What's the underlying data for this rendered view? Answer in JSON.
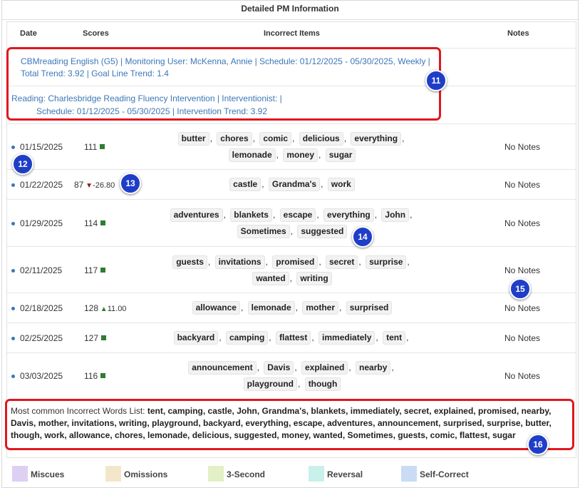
{
  "panel": {
    "title": "Detailed PM Information"
  },
  "columns": {
    "date": "Date",
    "scores": "Scores",
    "incorrect": "Incorrect Items",
    "notes": "Notes"
  },
  "monitoring": {
    "line1": "CBMreading English (G5) | Monitoring User: McKenna, Annie | Schedule: 01/12/2025 - 05/30/2025, Weekly |",
    "line2": "Total Trend: 3.92 | Goal Line Trend: 1.4"
  },
  "intervention": {
    "line1": "Reading: Charlesbridge Reading Fluency Intervention | Interventionist: |",
    "line2": "Schedule: 01/12/2025 - 05/30/2025 | Intervention Trend: 3.92"
  },
  "rows": [
    {
      "date": "01/15/2025",
      "score": "111",
      "trend": "",
      "notes": "No Notes",
      "words": [
        "butter",
        "chores",
        "comic",
        "delicious",
        "everything",
        "lemonade",
        "money",
        "sugar"
      ]
    },
    {
      "date": "01/22/2025",
      "score": "87",
      "trend": "-26.80",
      "notes": "No Notes",
      "words": [
        "castle",
        "Grandma's",
        "work"
      ]
    },
    {
      "date": "01/29/2025",
      "score": "114",
      "trend": "",
      "notes": "No Notes",
      "words": [
        "adventures",
        "blankets",
        "escape",
        "everything",
        "John",
        "Sometimes",
        "suggested"
      ]
    },
    {
      "date": "02/11/2025",
      "score": "117",
      "trend": "",
      "notes": "No Notes",
      "words": [
        "guests",
        "invitations",
        "promised",
        "secret",
        "surprise",
        "wanted",
        "writing"
      ]
    },
    {
      "date": "02/18/2025",
      "score": "128",
      "trend": "11.00",
      "notes": "No Notes",
      "words": [
        "allowance",
        "lemonade",
        "mother",
        "surprised"
      ]
    },
    {
      "date": "02/25/2025",
      "score": "127",
      "trend": "",
      "notes": "No Notes",
      "words": [
        "backyard",
        "camping",
        "flattest",
        "immediately",
        "tent"
      ]
    },
    {
      "date": "03/03/2025",
      "score": "116",
      "trend": "",
      "notes": "No Notes",
      "words": [
        "announcement",
        "Davis",
        "explained",
        "nearby",
        "playground",
        "though"
      ]
    }
  ],
  "common": {
    "label": "Most common Incorrect Words List:",
    "words": "tent, camping, castle, John, Grandma's, blankets, immediately, secret, explained, promised, nearby, Davis, mother, invitations, writing, playground, backyard, everything, escape, adventures, announcement, surprised, surprise, butter, though, work, allowance, chores, lemonade, delicious, suggested, money, wanted, Sometimes, guests, comic, flattest, sugar"
  },
  "legend": [
    {
      "label": "Miscues",
      "color": "#ddd0f3"
    },
    {
      "label": "Omissions",
      "color": "#f3e7c9"
    },
    {
      "label": "3-Second",
      "color": "#e3f0c6"
    },
    {
      "label": "Reversal",
      "color": "#c9f0ea"
    },
    {
      "label": "Self-Correct",
      "color": "#c9dcf3"
    }
  ],
  "callouts": [
    "11",
    "12",
    "13",
    "14",
    "15",
    "16"
  ],
  "colors": {
    "link": "#3d77b7",
    "highlight": "#e0171f",
    "callout": "#1f3ec8",
    "up": "#2e7d32",
    "down": "#8b1a1a"
  }
}
